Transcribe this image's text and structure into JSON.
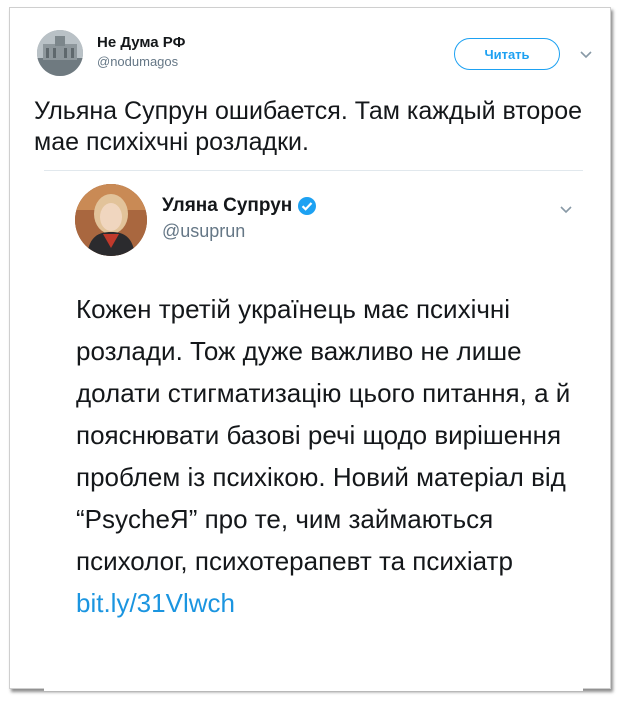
{
  "outer_tweet": {
    "author_name": "Не Дума РФ",
    "author_handle": "@nodumagos",
    "follow_label": "Читать",
    "text": "Ульяна Супрун ошибается. Там каждый второе мае психіхчні розладки."
  },
  "quoted_tweet": {
    "author_name": "Уляна Супрун",
    "author_handle": "@usuprun",
    "text": "Кожен третій українець має психічні розлади. Тож дуже важливо не лише долати стигматизацію цього питання, а й пояснювати базові речі щодо вирішення проблем із психікою. Новий матеріал від “PsycheЯ” про те, чим займаються психолог, психотерапевт та психіатр ",
    "link_text": "bit.ly/31Vlwch"
  },
  "icons": {
    "verified": "verified-badge-icon",
    "chevron": "chevron-down-icon"
  },
  "colors": {
    "accent": "#1da1f2",
    "link": "#1b95e0",
    "secondary_text": "#657786"
  }
}
